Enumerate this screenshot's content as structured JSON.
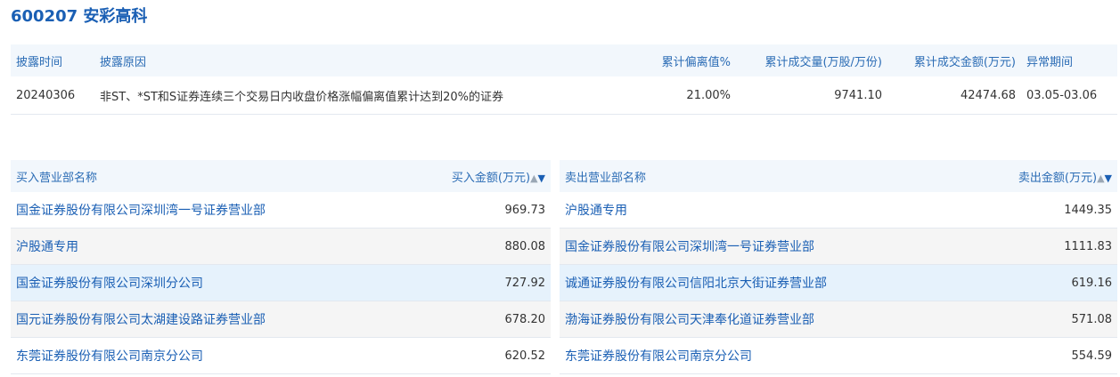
{
  "stock": {
    "title": "600207 安彩高科"
  },
  "summary": {
    "headers": [
      "披露时间",
      "披露原因",
      "累计偏离值%",
      "累计成交量(万股/万份)",
      "累计成交金额(万元)",
      "异常期间"
    ],
    "row": {
      "date": "20240306",
      "reason": "非ST、*ST和S证券连续三个交易日内收盘价格涨幅偏离值累计达到20%的证券",
      "deviation": "21.00%",
      "volume": "9741.10",
      "amount": "42474.68",
      "period": "03.05-03.06"
    }
  },
  "buy": {
    "header_name": "买入营业部名称",
    "header_amount": "买入金额(万元)",
    "sort_up": "▲",
    "sort_down": "▼",
    "rows": [
      {
        "name": "国金证券股份有限公司深圳湾一号证券营业部",
        "amount": "969.73"
      },
      {
        "name": "沪股通专用",
        "amount": "880.08"
      },
      {
        "name": "国金证券股份有限公司深圳分公司",
        "amount": "727.92"
      },
      {
        "name": "国元证券股份有限公司太湖建设路证券营业部",
        "amount": "678.20"
      },
      {
        "name": "东莞证券股份有限公司南京分公司",
        "amount": "620.52"
      }
    ]
  },
  "sell": {
    "header_name": "卖出营业部名称",
    "header_amount": "卖出金额(万元)",
    "sort_up": "▲",
    "sort_down": "▼",
    "rows": [
      {
        "name": "沪股通专用",
        "amount": "1449.35"
      },
      {
        "name": "国金证券股份有限公司深圳湾一号证券营业部",
        "amount": "1111.83"
      },
      {
        "name": "诚通证券股份有限公司信阳北京大街证券营业部",
        "amount": "619.16"
      },
      {
        "name": "渤海证券股份有限公司天津奉化道证券营业部",
        "amount": "571.08"
      },
      {
        "name": "东莞证券股份有限公司南京分公司",
        "amount": "554.59"
      }
    ]
  },
  "colors": {
    "accent": "#1a5fb4",
    "header_bg": "#f2f7fc",
    "highlight_row": "#e6f2fc",
    "alt_row": "#f5f5f5"
  }
}
